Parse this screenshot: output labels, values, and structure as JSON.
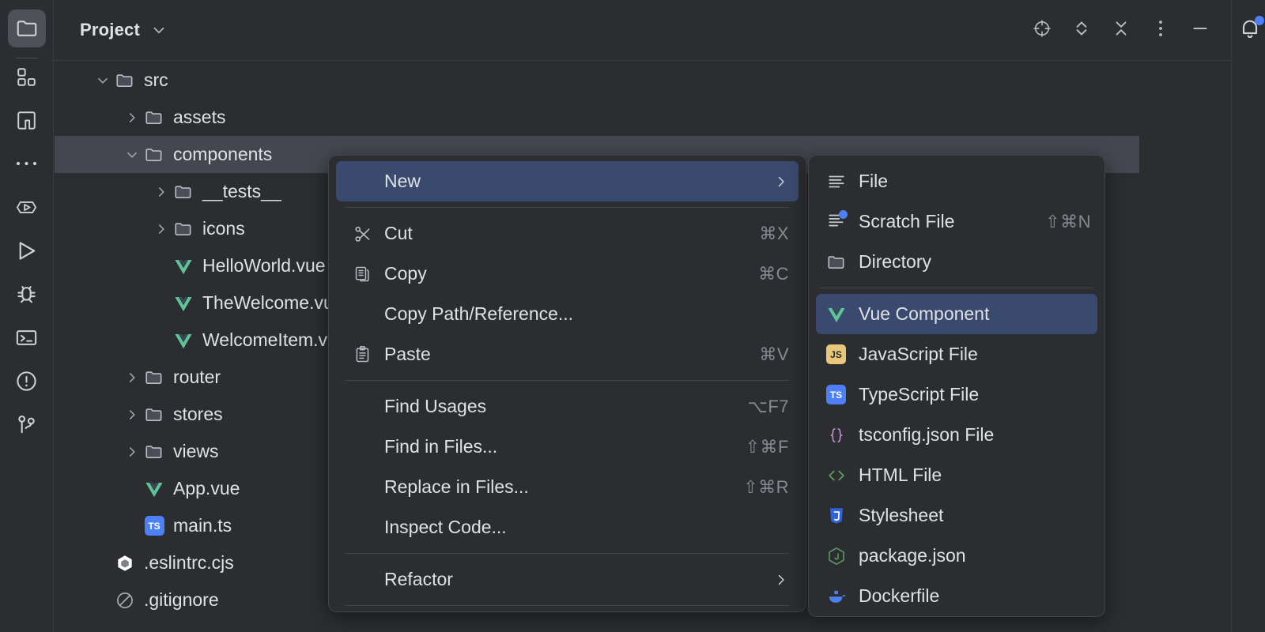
{
  "window": {
    "title": "Project",
    "background": "#2b2d30",
    "accent": "#3a4a6e",
    "selection_row": "#45464f"
  },
  "rail": {
    "items": [
      {
        "name": "project-tool-window",
        "icon": "folder-icon",
        "active": true
      },
      {
        "name": "structure-tool-window",
        "icon": "structure-icon",
        "active": false
      },
      {
        "name": "bookmarks-tool-window",
        "icon": "bookmark-icon",
        "active": false
      },
      {
        "name": "more-tool-windows",
        "icon": "ellipsis-icon",
        "active": false
      },
      {
        "name": "services-tool-window",
        "icon": "services-play-icon",
        "active": false
      },
      {
        "name": "run-tool-window",
        "icon": "run-play-icon",
        "active": false
      },
      {
        "name": "debug-tool-window",
        "icon": "bug-icon",
        "active": false
      },
      {
        "name": "terminal-tool-window",
        "icon": "terminal-icon",
        "active": false
      },
      {
        "name": "problems-tool-window",
        "icon": "warning-circle-icon",
        "active": false
      },
      {
        "name": "version-control-tool-window",
        "icon": "branch-icon",
        "active": false
      }
    ]
  },
  "header": {
    "title": "Project",
    "dropdown_icon": "chevron-down-icon",
    "actions": [
      {
        "name": "scroll-from-source-button",
        "icon": "crosshair-icon"
      },
      {
        "name": "expand-all-button",
        "icon": "expand-all-icon"
      },
      {
        "name": "collapse-all-button",
        "icon": "collapse-all-icon"
      },
      {
        "name": "more-options-button",
        "icon": "vertical-dots-icon"
      },
      {
        "name": "minimize-button",
        "icon": "minimize-icon"
      }
    ]
  },
  "notifications": {
    "icon": "bell-icon",
    "badge": true,
    "badge_color": "#4d7ff5"
  },
  "tree": {
    "rows": [
      {
        "label": "src",
        "indent": 1,
        "arrow": "down",
        "icon": "folder-icon",
        "selected": false
      },
      {
        "label": "assets",
        "indent": 2,
        "arrow": "right",
        "icon": "folder-icon",
        "selected": false
      },
      {
        "label": "components",
        "indent": 2,
        "arrow": "down",
        "icon": "folder-icon",
        "selected": true
      },
      {
        "label": "__tests__",
        "indent": 3,
        "arrow": "right",
        "icon": "folder-icon",
        "selected": false
      },
      {
        "label": "icons",
        "indent": 3,
        "arrow": "right",
        "icon": "folder-icon",
        "selected": false
      },
      {
        "label": "HelloWorld.vue",
        "indent": 3,
        "arrow": "none",
        "icon": "vue-icon",
        "selected": false
      },
      {
        "label": "TheWelcome.vue",
        "indent": 3,
        "arrow": "none",
        "icon": "vue-icon",
        "selected": false
      },
      {
        "label": "WelcomeItem.vue",
        "indent": 3,
        "arrow": "none",
        "icon": "vue-icon",
        "selected": false
      },
      {
        "label": "router",
        "indent": 2,
        "arrow": "right",
        "icon": "folder-icon",
        "selected": false
      },
      {
        "label": "stores",
        "indent": 2,
        "arrow": "right",
        "icon": "folder-icon",
        "selected": false
      },
      {
        "label": "views",
        "indent": 2,
        "arrow": "right",
        "icon": "folder-icon",
        "selected": false
      },
      {
        "label": "App.vue",
        "indent": 2,
        "arrow": "none",
        "icon": "vue-icon",
        "selected": false
      },
      {
        "label": "main.ts",
        "indent": 2,
        "arrow": "none",
        "icon": "ts-icon",
        "selected": false
      },
      {
        "label": ".eslintrc.cjs",
        "indent": 1,
        "arrow": "none",
        "icon": "eslint-icon",
        "selected": false
      },
      {
        "label": ".gitignore",
        "indent": 1,
        "arrow": "none",
        "icon": "gitignore-icon",
        "selected": false
      }
    ]
  },
  "context_menu": {
    "items": [
      {
        "label": "New",
        "icon": "none",
        "accel": "",
        "submenu": true,
        "highlighted": true,
        "separator_after": true
      },
      {
        "label": "Cut",
        "icon": "scissors-icon",
        "accel": "⌘X",
        "submenu": false,
        "highlighted": false,
        "separator_after": false
      },
      {
        "label": "Copy",
        "icon": "copy-icon",
        "accel": "⌘C",
        "submenu": false,
        "highlighted": false,
        "separator_after": false
      },
      {
        "label": "Copy Path/Reference...",
        "icon": "none",
        "accel": "",
        "submenu": false,
        "highlighted": false,
        "separator_after": false
      },
      {
        "label": "Paste",
        "icon": "paste-icon",
        "accel": "⌘V",
        "submenu": false,
        "highlighted": false,
        "separator_after": true
      },
      {
        "label": "Find Usages",
        "icon": "none",
        "accel": "⌥F7",
        "submenu": false,
        "highlighted": false,
        "separator_after": false
      },
      {
        "label": "Find in Files...",
        "icon": "none",
        "accel": "⇧⌘F",
        "submenu": false,
        "highlighted": false,
        "separator_after": false
      },
      {
        "label": "Replace in Files...",
        "icon": "none",
        "accel": "⇧⌘R",
        "submenu": false,
        "highlighted": false,
        "separator_after": false
      },
      {
        "label": "Inspect Code...",
        "icon": "none",
        "accel": "",
        "submenu": false,
        "highlighted": false,
        "separator_after": true
      },
      {
        "label": "Refactor",
        "icon": "none",
        "accel": "",
        "submenu": true,
        "highlighted": false,
        "separator_after": true
      }
    ]
  },
  "new_submenu": {
    "items": [
      {
        "label": "File",
        "icon": "file-lines-icon",
        "accel": "",
        "highlighted": false,
        "separator_after": false
      },
      {
        "label": "Scratch File",
        "icon": "scratch-file-icon",
        "accel": "⇧⌘N",
        "highlighted": false,
        "separator_after": false
      },
      {
        "label": "Directory",
        "icon": "folder-icon",
        "accel": "",
        "highlighted": false,
        "separator_after": true
      },
      {
        "label": "Vue Component",
        "icon": "vue-icon",
        "accel": "",
        "highlighted": true,
        "separator_after": false
      },
      {
        "label": "JavaScript File",
        "icon": "js-badge-icon",
        "accel": "",
        "highlighted": false,
        "separator_after": false
      },
      {
        "label": "TypeScript File",
        "icon": "ts-badge-icon",
        "accel": "",
        "highlighted": false,
        "separator_after": false
      },
      {
        "label": "tsconfig.json File",
        "icon": "braces-icon",
        "accel": "",
        "highlighted": false,
        "separator_after": false
      },
      {
        "label": "HTML File",
        "icon": "angle-brackets-icon",
        "accel": "",
        "highlighted": false,
        "separator_after": false
      },
      {
        "label": "Stylesheet",
        "icon": "css-shield-icon",
        "accel": "",
        "highlighted": false,
        "separator_after": false
      },
      {
        "label": "package.json",
        "icon": "nodejs-icon",
        "accel": "",
        "highlighted": false,
        "separator_after": false
      },
      {
        "label": "Dockerfile",
        "icon": "docker-icon",
        "accel": "",
        "highlighted": false,
        "separator_after": false
      }
    ]
  }
}
